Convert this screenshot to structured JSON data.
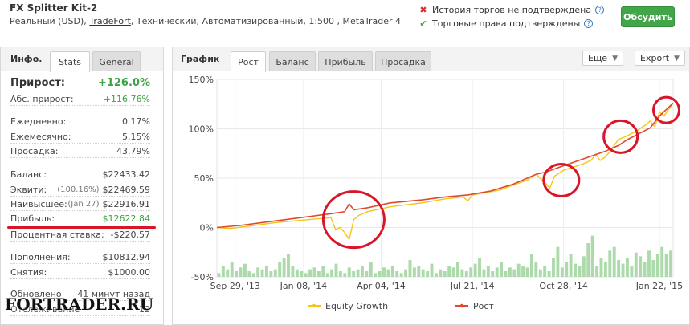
{
  "account": {
    "title": "FX Splitter Kit-2",
    "type": "Реальный (USD),",
    "broker": "TradeFort",
    "details": ", Технический, Автоматизированный, 1:500 , MetaTrader 4"
  },
  "status": {
    "history": "История торгов не подтверждена",
    "rights": "Торговые права подтверждены"
  },
  "discuss_button": "Обсудить",
  "info": {
    "title": "Инфо.",
    "tabs": [
      "Stats",
      "General"
    ],
    "rows": {
      "growth": {
        "label": "Прирост:",
        "value": "+126.0%"
      },
      "abs_growth": {
        "label": "Абс. прирост:",
        "value": "+116.76%"
      },
      "daily": {
        "label": "Ежедневно:",
        "value": "0.17%"
      },
      "monthly": {
        "label": "Ежемесячно:",
        "value": "5.15%"
      },
      "drawdown": {
        "label": "Просадка:",
        "value": "43.79%"
      },
      "balance": {
        "label": "Баланс:",
        "value": "$22433.42"
      },
      "equity": {
        "label": "Эквити:",
        "note": "(100.16%)",
        "value": "$22469.59"
      },
      "highest": {
        "label": "Наивысшее:",
        "note": "(Jan 27)",
        "value": "$22916.91"
      },
      "profit": {
        "label": "Прибыль:",
        "value": "$12622.84"
      },
      "interest": {
        "label": "Процентная ставка:",
        "value": "-$220.57"
      },
      "deposits": {
        "label": "Пополнения:",
        "value": "$10812.94"
      },
      "withdrawals": {
        "label": "Снятия:",
        "value": "$1000.00"
      },
      "updated": {
        "label": "Обновлено",
        "value": "41 минут назад"
      },
      "tracking": {
        "label": "Отслеживание",
        "value": "12"
      }
    }
  },
  "chart_panel": {
    "title": "График",
    "tabs": [
      "Рост",
      "Баланс",
      "Прибыль",
      "Просадка"
    ],
    "more": "Ещё",
    "export": "Export"
  },
  "chart_data": {
    "type": "line",
    "y_ticks": [
      "150%",
      "100%",
      "50%",
      "0%",
      "-50%"
    ],
    "ylim": [
      -50,
      150
    ],
    "x_ticks": [
      "Sep 29, '13",
      "Jan 08, '14",
      "Apr 04, '14",
      "Jul 21, '14",
      "Oct 28, '14",
      "Jan 22, '15"
    ],
    "grid": true,
    "legend": {
      "position": "bottom"
    },
    "series": [
      {
        "name": "Equity Growth",
        "color": "#f5c518",
        "x": [
          0,
          0.03,
          0.08,
          0.13,
          0.2,
          0.25,
          0.26,
          0.27,
          0.28,
          0.29,
          0.3,
          0.31,
          0.33,
          0.38,
          0.45,
          0.5,
          0.54,
          0.55,
          0.56,
          0.62,
          0.68,
          0.7,
          0.71,
          0.72,
          0.73,
          0.74,
          0.76,
          0.8,
          0.82,
          0.83,
          0.84,
          0.85,
          0.86,
          0.88,
          0.9,
          0.92,
          0.94,
          0.95,
          0.96,
          0.97,
          0.98,
          1.0
        ],
        "values": [
          0,
          -1,
          2,
          5,
          8,
          10,
          -2,
          0,
          -5,
          -12,
          8,
          12,
          16,
          21,
          25,
          29,
          31,
          27,
          33,
          38,
          48,
          54,
          49,
          45,
          40,
          52,
          58,
          64,
          68,
          74,
          68,
          71,
          76,
          89,
          93,
          98,
          104,
          108,
          102,
          117,
          113,
          126
        ]
      },
      {
        "name": "Рост",
        "color": "#e04a2a",
        "x": [
          0,
          0.05,
          0.1,
          0.15,
          0.2,
          0.25,
          0.28,
          0.29,
          0.3,
          0.33,
          0.38,
          0.45,
          0.5,
          0.55,
          0.6,
          0.65,
          0.7,
          0.72,
          0.75,
          0.8,
          0.85,
          0.88,
          0.9,
          0.95,
          0.97,
          1.0
        ],
        "values": [
          0,
          2,
          5,
          8,
          11,
          14,
          16,
          24,
          18,
          20,
          25,
          28,
          31,
          33,
          37,
          44,
          54,
          56,
          61,
          69,
          77,
          83,
          89,
          101,
          113,
          126
        ]
      }
    ],
    "bars": {
      "name": "volume",
      "color": "#9fd49c",
      "values": [
        2,
        6,
        4,
        8,
        3,
        5,
        7,
        3,
        2,
        5,
        4,
        6,
        3,
        4,
        8,
        10,
        12,
        6,
        4,
        3,
        2,
        4,
        5,
        3,
        6,
        2,
        4,
        7,
        3,
        2,
        5,
        3,
        4,
        6,
        3,
        8,
        2,
        3,
        5,
        4,
        6,
        3,
        2,
        4,
        9,
        5,
        6,
        4,
        3,
        7,
        2,
        4,
        3,
        6,
        5,
        8,
        4,
        3,
        5,
        7,
        10,
        4,
        6,
        3,
        5,
        8,
        3,
        5,
        4,
        7,
        6,
        5,
        12,
        8,
        4,
        6,
        3,
        10,
        16,
        5,
        8,
        12,
        7,
        6,
        11,
        18,
        22,
        6,
        10,
        8,
        14,
        16,
        9,
        7,
        10,
        6,
        13,
        11,
        8,
        14,
        9,
        12,
        16,
        12,
        14
      ]
    }
  },
  "watermark": "FORTRADER.RU"
}
